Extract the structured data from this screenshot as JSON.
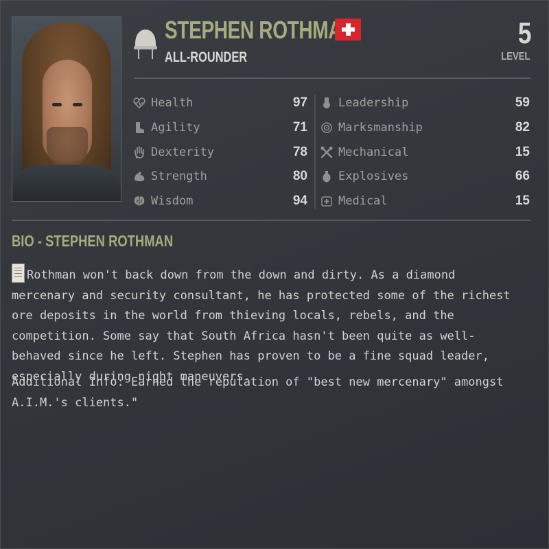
{
  "merc": {
    "name": "STEPHEN ROTHMAN",
    "nationality_flag": "switzerland-flag",
    "role": "ALL-ROUNDER",
    "level_value": "5",
    "level_label": "LEVEL",
    "portrait": "merc-portrait"
  },
  "stats_left": [
    {
      "label": "Health",
      "value": "97",
      "icon": "heart-icon"
    },
    {
      "label": "Agility",
      "value": "71",
      "icon": "boot-icon"
    },
    {
      "label": "Dexterity",
      "value": "78",
      "icon": "hand-icon"
    },
    {
      "label": "Strength",
      "value": "80",
      "icon": "arm-icon"
    },
    {
      "label": "Wisdom",
      "value": "94",
      "icon": "brain-icon"
    }
  ],
  "stats_right": [
    {
      "label": "Leadership",
      "value": "59",
      "icon": "medal-icon"
    },
    {
      "label": "Marksmanship",
      "value": "82",
      "icon": "crosshair-icon"
    },
    {
      "label": "Mechanical",
      "value": "15",
      "icon": "tools-icon"
    },
    {
      "label": "Explosives",
      "value": "66",
      "icon": "grenade-icon"
    },
    {
      "label": "Medical",
      "value": "15",
      "icon": "medkit-icon"
    }
  ],
  "bio": {
    "title": "BIO - STEPHEN ROTHMAN",
    "text": "Rothman won't back down from the down and dirty. As a diamond mercenary and security consultant, he has protected some of the richest ore deposits in the world from thieving locals, rebels, and the competition. Some say that South Africa hasn't been quite as well-behaved since he left. Stephen has proven to be a fine squad leader, especially during night maneuvers.",
    "additional": "Additional Info: Earned the reputation of \"best new mercenary\" amongst A.I.M.'s clients.\""
  },
  "colors": {
    "accent": "#a7ab7f",
    "background": "#383c41",
    "text": "#d6d6d2",
    "flag_red": "#d8242a"
  }
}
